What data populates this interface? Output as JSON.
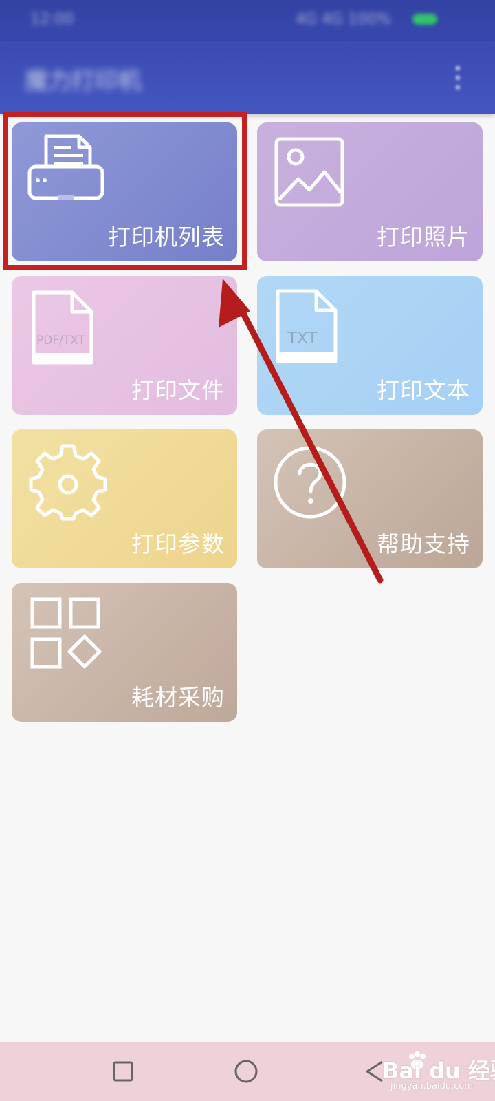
{
  "status_bar": {
    "time": "12:00",
    "icons": "4G 4G 100%"
  },
  "app_bar": {
    "title": "魔力打印机",
    "menu_icon": "more-vert-icon"
  },
  "menu_tiles": [
    {
      "label": "打印机列表",
      "icon": "printer-icon",
      "color": "#7e89cf"
    },
    {
      "label": "打印照片",
      "icon": "image-icon",
      "color": "#c3aadb"
    },
    {
      "label": "打印文件",
      "icon": "document-pdf-icon",
      "icon_text": "PDF/TXT",
      "color": "#e6c1e1"
    },
    {
      "label": "打印文本",
      "icon": "document-txt-icon",
      "icon_text": "TXT",
      "color": "#a9d3f5"
    },
    {
      "label": "打印参数",
      "icon": "gear-icon",
      "color": "#f0da96"
    },
    {
      "label": "帮助支持",
      "icon": "help-icon",
      "color": "#c6b2a3"
    },
    {
      "label": "耗材采购",
      "icon": "grid-icon",
      "color": "#c9b5a7"
    }
  ],
  "annotation": {
    "highlight_color": "#c42222"
  },
  "nav_bar": {
    "icons": [
      "recent-apps-icon",
      "home-icon",
      "back-icon"
    ]
  },
  "watermark": {
    "main": "Bai du 经验",
    "sub": "jingyan.baidu.com"
  }
}
